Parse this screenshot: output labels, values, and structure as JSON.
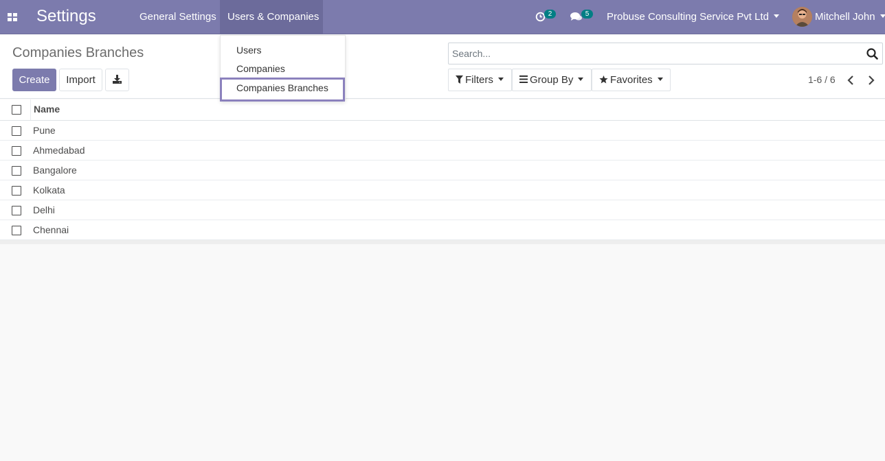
{
  "navbar": {
    "app_title": "Settings",
    "menus": [
      "General Settings",
      "Users & Companies"
    ],
    "activity_badge": "2",
    "messages_badge": "5",
    "company": "Probuse Consulting Service Pvt Ltd",
    "user": "Mitchell John",
    "icons": {
      "apps": "apps-grid-icon",
      "activity": "clock-icon",
      "messages": "chat-bubbles-icon"
    }
  },
  "dropdown": {
    "items": [
      "Users",
      "Companies",
      "Companies Branches"
    ],
    "highlighted": "Companies Branches"
  },
  "control_panel": {
    "title": "Companies Branches",
    "create_label": "Create",
    "import_label": "Import",
    "search_placeholder": "Search...",
    "filters_label": "Filters",
    "group_by_label": "Group By",
    "favorites_label": "Favorites",
    "pager": "1-6 / 6"
  },
  "list": {
    "column_name": "Name",
    "rows": [
      "Pune",
      "Ahmedabad",
      "Bangalore",
      "Kolkata",
      "Delhi",
      "Chennai"
    ]
  },
  "colors": {
    "brand": "#7c7bad",
    "menu_active": "#6c6b9b",
    "badge": "#017e84",
    "highlight": "#8b81bd"
  }
}
